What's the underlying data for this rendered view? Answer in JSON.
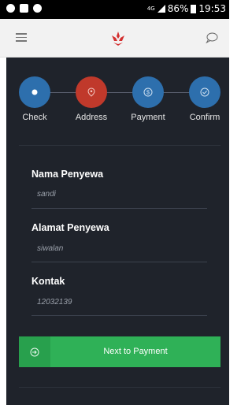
{
  "status_bar": {
    "network": "4G",
    "battery": "86%",
    "time": "19:53"
  },
  "app_bar": {
    "menu_icon": "menu-icon",
    "logo_icon": "flower-logo",
    "chat_icon": "chat-bubble-icon"
  },
  "steps": [
    {
      "label": "Check",
      "color": "#2d6fad",
      "icon": "dot-icon"
    },
    {
      "label": "Address",
      "color": "#c0392b",
      "icon": "location-pin-icon"
    },
    {
      "label": "Payment",
      "color": "#2d6fad",
      "icon": "dollar-icon"
    },
    {
      "label": "Confirm",
      "color": "#2d6fad",
      "icon": "check-circle-icon"
    }
  ],
  "form": {
    "fields": [
      {
        "label": "Nama Penyewa",
        "value": "sandi"
      },
      {
        "label": "Alamat Penyewa",
        "value": "siwalan"
      },
      {
        "label": "Kontak",
        "value": "12032139"
      }
    ]
  },
  "next_button": {
    "label": "Next to Payment",
    "icon": "sign-in-icon",
    "color": "#2fb157"
  }
}
